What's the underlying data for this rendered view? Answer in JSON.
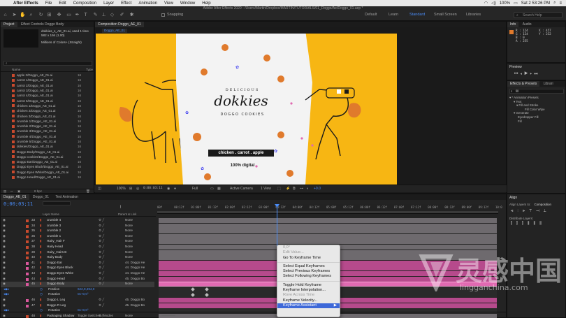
{
  "menubar": {
    "app": "After Effects",
    "items": [
      "File",
      "Edit",
      "Composition",
      "Layer",
      "Effect",
      "Animation",
      "View",
      "Window",
      "Help"
    ],
    "status_battery": "100%",
    "clock": "Sat 2 53:26 PM"
  },
  "titlebar": {
    "title": "Adobe After Effects 2020 - /Users/Martin/Dropbox/MARTIN/TUTORIALS/01_Doggo/Ae/Doggo_01.aep *"
  },
  "toolbar": {
    "snapping_label": "Snapping",
    "workspaces": [
      "Default",
      "Learn",
      "Standard",
      "Small Screen",
      "Libraries"
    ],
    "active_workspace": "Standard",
    "help_placeholder": "Search Help"
  },
  "project": {
    "tabs": [
      "Project",
      "Effect Controls Doggo Body"
    ],
    "item_name": "dokkies_s_AE_01.ai",
    "item_used": ", used 1 time",
    "item_dims": "582 x 194 (1.00)",
    "item_desc": "Millions of Colors+ (Straight)",
    "search_placeholder": "⌕",
    "col_name": "Name",
    "col_type": "Type",
    "footer": "8 bpc",
    "items": [
      "apple 2/Doggo_AE_01.ai",
      "carrot 1/Doggo_AE_01.ai",
      "carrot 2/Doggo_AE_01.ai",
      "carrot 3/Doggo_AE_01.ai",
      "carrot 4/Doggo_AE_01.ai",
      "carrot 5/Doggo_AE_01.ai",
      "chicken 1/Doggo_AE_01.ai",
      "chicken 2/Doggo_AE_01.ai",
      "chicken 3/Doggo_AE_01.ai",
      "crumble 1/Doggo_AE_01.ai",
      "crumble 2/Doggo_AE_01.ai",
      "crumble 3/Doggo_AE_01.ai",
      "crumble 4/Doggo_AE_01.ai",
      "crumble 5/Doggo_AE_01.ai",
      "dokkies/Doggo_AE_01.ai",
      "Doggo Body/Doggo_AE_01.ai",
      "Doggo cookies/Doggo_AE_01.ai",
      "Doggo Ear/Doggo_AE_01.ai",
      "Doggo Eyes Black/Doggo_AE_01.ai",
      "Doggo Eyes White/Doggo_AE_01.ai",
      "Doggo Head/Doggo_AE_01.ai"
    ],
    "item_num": "16"
  },
  "composition": {
    "tab_label": "Composition Doggo_AE_01",
    "crumb": "Doggo_AE_01",
    "zoom": "100%",
    "timecode": "0:00:03:11",
    "resolution": "Full",
    "camera": "Active Camera",
    "view": "1 View",
    "exposure": "+0.0",
    "art": {
      "brand": "dokkies",
      "tagline_top": "DELICIOUS",
      "tagline_bottom": "DOGGO COOKIES",
      "flavors": "chicken . carrot . apple",
      "digital": "100% digital"
    }
  },
  "info_panel": {
    "tabs": [
      "Info",
      "Audio"
    ],
    "r": "R : 124",
    "g": "G : 124",
    "b": "B : 0",
    "a": "A : 255",
    "x": "X : 457",
    "y": "Y : 232"
  },
  "preview_panel": {
    "title": "Preview"
  },
  "effects_panel": {
    "tabs": [
      "Effects & Presets",
      "Librari"
    ],
    "search_value": "fill",
    "tree": [
      "▾ * Animation Presets",
      "▾ Text",
      "▾ Fill and Stroke",
      "Fill Color Wipe",
      "▾ Generate",
      "Eyedropper Fill",
      "Fill"
    ]
  },
  "align_panel": {
    "title": "Align",
    "align_to_label": "Align Layers to:",
    "align_to_value": "Composition",
    "distribute_label": "Distribute Layers:"
  },
  "timeline": {
    "tabs": [
      "Doggo_AE_01",
      "Doggo_01",
      "Text Animation"
    ],
    "timecode": "0;00;03;11",
    "col_layer": "Layer Name",
    "col_parent": "Parent & Link",
    "footer": "Toggle Switches / Modes",
    "ruler": [
      "00f",
      "00:12f",
      "01:00f",
      "01:12f",
      "02:00f",
      "02:12f",
      "03:00f",
      "03:12f",
      "04:00f",
      "04:12f",
      "05:00f",
      "05:12f",
      "06:00f",
      "06:12f",
      "07:00f",
      "07:12f",
      "08:00f",
      "08:12f",
      "09:00f",
      "09:12f",
      "10:0"
    ],
    "layers": [
      {
        "idx": "33",
        "name": "crumble 4",
        "parent": "None",
        "label": "#c84a2e",
        "bar": "#6e6a6e",
        "sel": false
      },
      {
        "idx": "34",
        "name": "crumble 3",
        "parent": "None",
        "label": "#c84a2e",
        "bar": "#6e6a6e",
        "sel": false
      },
      {
        "idx": "35",
        "name": "crumble 2",
        "parent": "None",
        "label": "#c84a2e",
        "bar": "#6e6a6e",
        "sel": false
      },
      {
        "idx": "36",
        "name": "crumble 1",
        "parent": "None",
        "label": "#c84a2e",
        "bar": "#6e6a6e",
        "sel": false
      },
      {
        "idx": "37",
        "name": "Hairy_Hair F",
        "parent": "None",
        "label": "#c84a2e",
        "bar": "#6e6a6e",
        "sel": false
      },
      {
        "idx": "38",
        "name": "Hairy Head",
        "parent": "None",
        "label": "#c84a2e",
        "bar": "#6e6a6e",
        "sel": false
      },
      {
        "idx": "39",
        "name": "Hairy_Hairs B",
        "parent": "None",
        "label": "#c84a2e",
        "bar": "#6e6a6e",
        "sel": false
      },
      {
        "idx": "40",
        "name": "Hairy Body",
        "parent": "None",
        "label": "#c84a2e",
        "bar": "#6e6a6e",
        "sel": false
      },
      {
        "idx": "41",
        "name": "Doggo Ear",
        "parent": "44. Doggo He",
        "label": "#d9579c",
        "bar": "#b64a8c",
        "sel": false
      },
      {
        "idx": "42",
        "name": "Doggo Eyes Black",
        "parent": "44. Doggo He",
        "label": "#d9579c",
        "bar": "#b64a8c",
        "sel": false
      },
      {
        "idx": "43",
        "name": "Doggo Eyes White",
        "parent": "44. Doggo He",
        "label": "#d9579c",
        "bar": "#b64a8c",
        "sel": false
      },
      {
        "idx": "44",
        "name": "Doggo Head",
        "parent": "45. Doggo Bo",
        "label": "#d9579c",
        "bar": "#b64a8c",
        "sel": false
      },
      {
        "idx": "45",
        "name": "Doggo Body",
        "parent": "None",
        "label": "#d9579c",
        "bar": "#e06ab1",
        "sel": true
      }
    ],
    "props": [
      {
        "name": "Position",
        "value": "622,9,494,0"
      },
      {
        "name": "Rotation",
        "value": "0x+0,0°"
      }
    ],
    "layers2": [
      {
        "idx": "46",
        "name": "Doggo L Leg",
        "parent": "45. Doggo Bo",
        "label": "#d9579c",
        "bar": "#b64a8c"
      },
      {
        "idx": "47",
        "name": "Doggo R Leg",
        "parent": "45. Doggo Bo",
        "label": "#d9579c",
        "bar": "#b64a8c"
      }
    ],
    "sub_prop": {
      "name": "Rotation",
      "value": "0x+0,0°"
    },
    "layer_last": {
      "idx": "48",
      "name": "Packaging Shadow",
      "parent": "None",
      "label": "#c84a2e",
      "bar": "#6e6a6e"
    }
  },
  "context_menu": {
    "items": [
      {
        "label": "0,0°",
        "disabled": true
      },
      {
        "label": "Edit Value...",
        "disabled": true
      },
      {
        "label": "Go To Keyframe Time",
        "disabled": false
      },
      {
        "sep": true
      },
      {
        "label": "Select Equal Keyframes",
        "disabled": false
      },
      {
        "label": "Select Previous Keyframes",
        "disabled": false
      },
      {
        "label": "Select Following Keyframes",
        "disabled": false
      },
      {
        "sep": true
      },
      {
        "label": "Toggle Hold Keyframe",
        "disabled": false
      },
      {
        "label": "Keyframe Interpolation...",
        "disabled": false
      },
      {
        "label": "Rove Across Time",
        "disabled": true
      },
      {
        "label": "Keyframe Velocity...",
        "disabled": false
      },
      {
        "label": "Keyframe Assistant",
        "disabled": false,
        "highlight": true
      }
    ]
  },
  "watermark": {
    "text_cn": "灵感中国",
    "text_en": "lingganchina.com"
  },
  "colors": {
    "accent": "#4a8cf7",
    "comp_bg": "#f7b613",
    "pink_label": "#d9579c",
    "playhead": "#4a8cf7"
  }
}
